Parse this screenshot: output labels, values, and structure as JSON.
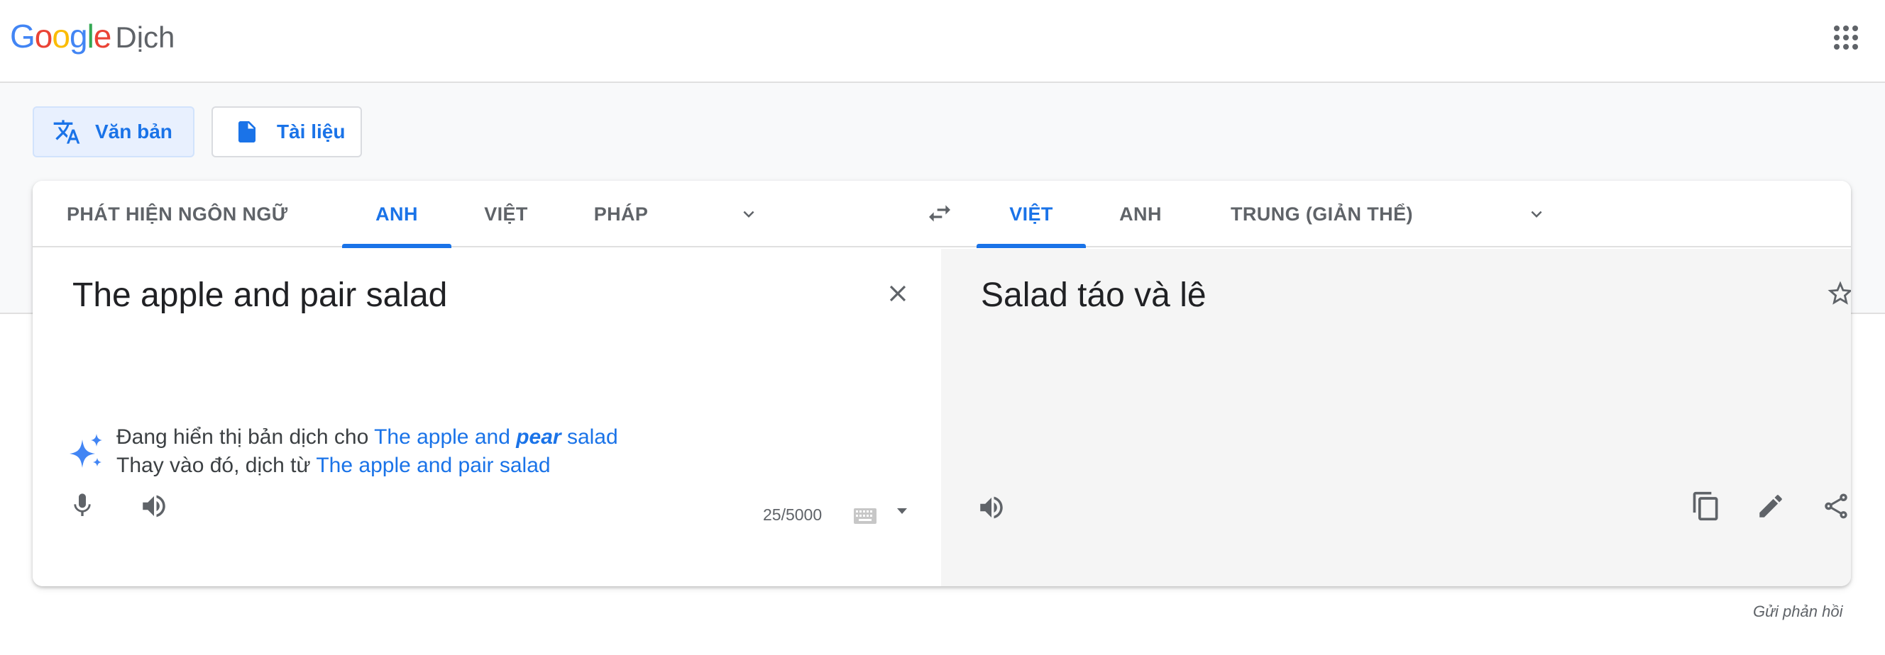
{
  "header": {
    "logo_letters": [
      {
        "ch": "G",
        "color": "#4285f4"
      },
      {
        "ch": "o",
        "color": "#ea4335"
      },
      {
        "ch": "o",
        "color": "#fbbc05"
      },
      {
        "ch": "g",
        "color": "#4285f4"
      },
      {
        "ch": "l",
        "color": "#34a853"
      },
      {
        "ch": "e",
        "color": "#ea4335"
      }
    ],
    "product_name": "Dịch",
    "apps_icon": "apps-grid-icon"
  },
  "modes": {
    "text_label": "Văn bản",
    "text_icon": "translate-icon",
    "document_label": "Tài liệu",
    "document_icon": "document-icon"
  },
  "source_langs": {
    "detect": "PHÁT HIỆN NGÔN NGỮ",
    "tabs": [
      "ANH",
      "VIỆT",
      "PHÁP"
    ],
    "active": "ANH"
  },
  "target_langs": {
    "tabs": [
      "VIỆT",
      "ANH",
      "TRUNG (GIẢN THỂ)"
    ],
    "active": "VIỆT"
  },
  "source": {
    "text": "The apple and pair salad",
    "char_count": "25/5000"
  },
  "suggestion": {
    "line1_prefix": "Đang hiển thị bản dịch cho",
    "corrected_part1": "The apple and",
    "corrected_bold": "pear",
    "corrected_part2": "salad",
    "line2_prefix": "Thay vào đó, dịch từ",
    "original": "The apple and pair salad"
  },
  "target": {
    "text": "Salad táo và lê"
  },
  "footer": {
    "feedback": "Gửi phản hồi"
  },
  "colors": {
    "accent": "#1a73e8",
    "active_mode_bg": "#e8f0fe",
    "target_pane_bg": "#f5f5f5"
  }
}
